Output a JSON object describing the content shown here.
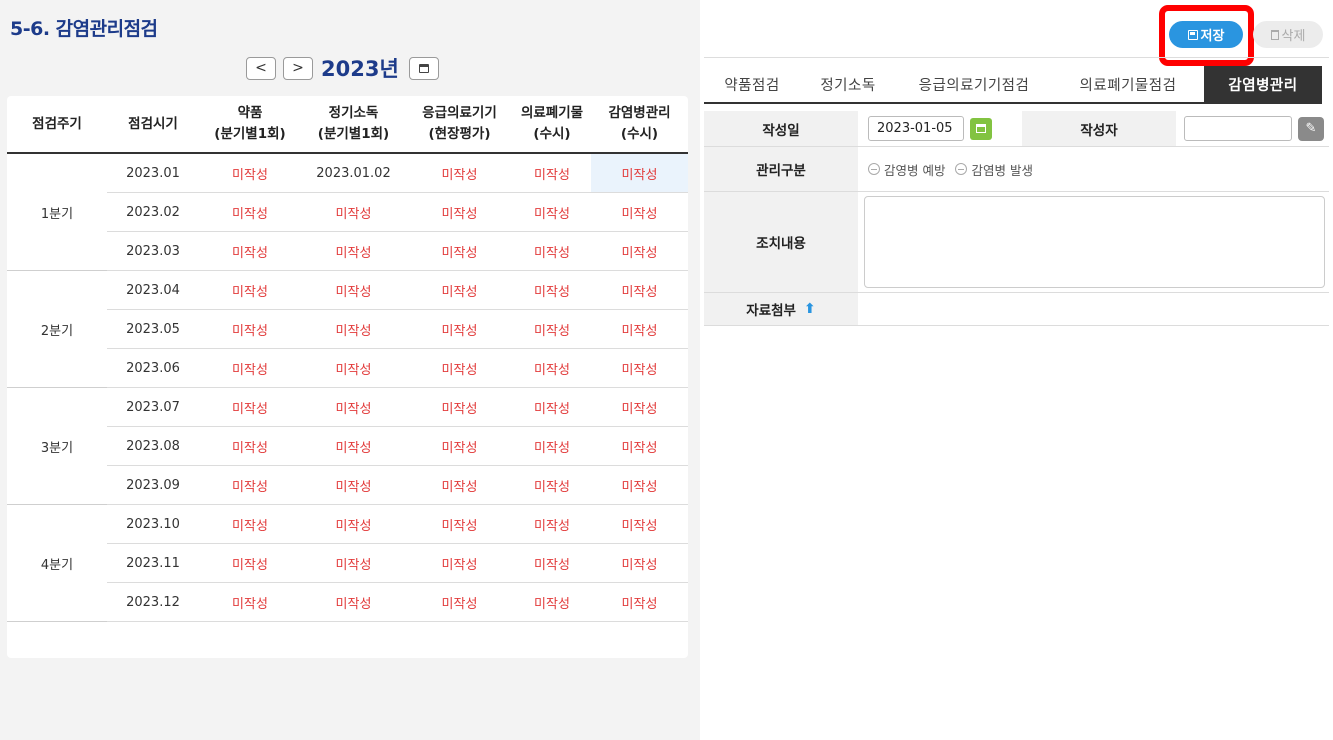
{
  "page_title": "5-6. 감염관리점검",
  "year_nav": {
    "prev": "<",
    "next": ">",
    "year": "2023년",
    "calendar_icon": "calendar-icon"
  },
  "table": {
    "headers": [
      {
        "line1": "점검주기",
        "line2": ""
      },
      {
        "line1": "점검시기",
        "line2": ""
      },
      {
        "line1": "약품",
        "line2": "(분기별1회)"
      },
      {
        "line1": "정기소독",
        "line2": "(분기별1회)"
      },
      {
        "line1": "응급의료기기",
        "line2": "(현장평가)"
      },
      {
        "line1": "의료폐기물",
        "line2": "(수시)"
      },
      {
        "line1": "감염병관리",
        "line2": "(수시)"
      }
    ],
    "quarters": [
      "1분기",
      "2분기",
      "3분기",
      "4분기"
    ],
    "rows": [
      {
        "month": "2023.01",
        "c": [
          "미작성",
          "2023.01.02",
          "미작성",
          "미작성",
          "미작성"
        ]
      },
      {
        "month": "2023.02",
        "c": [
          "미작성",
          "미작성",
          "미작성",
          "미작성",
          "미작성"
        ]
      },
      {
        "month": "2023.03",
        "c": [
          "미작성",
          "미작성",
          "미작성",
          "미작성",
          "미작성"
        ]
      },
      {
        "month": "2023.04",
        "c": [
          "미작성",
          "미작성",
          "미작성",
          "미작성",
          "미작성"
        ]
      },
      {
        "month": "2023.05",
        "c": [
          "미작성",
          "미작성",
          "미작성",
          "미작성",
          "미작성"
        ]
      },
      {
        "month": "2023.06",
        "c": [
          "미작성",
          "미작성",
          "미작성",
          "미작성",
          "미작성"
        ]
      },
      {
        "month": "2023.07",
        "c": [
          "미작성",
          "미작성",
          "미작성",
          "미작성",
          "미작성"
        ]
      },
      {
        "month": "2023.08",
        "c": [
          "미작성",
          "미작성",
          "미작성",
          "미작성",
          "미작성"
        ]
      },
      {
        "month": "2023.09",
        "c": [
          "미작성",
          "미작성",
          "미작성",
          "미작성",
          "미작성"
        ]
      },
      {
        "month": "2023.10",
        "c": [
          "미작성",
          "미작성",
          "미작성",
          "미작성",
          "미작성"
        ]
      },
      {
        "month": "2023.11",
        "c": [
          "미작성",
          "미작성",
          "미작성",
          "미작성",
          "미작성"
        ]
      },
      {
        "month": "2023.12",
        "c": [
          "미작성",
          "미작성",
          "미작성",
          "미작성",
          "미작성"
        ]
      }
    ]
  },
  "toolbar": {
    "save_label": "저장",
    "delete_label": "삭제"
  },
  "tabs": [
    {
      "label": "약품점검",
      "active": false
    },
    {
      "label": "정기소독",
      "active": false
    },
    {
      "label": "응급의료기기점검",
      "active": false
    },
    {
      "label": "의료폐기물점검",
      "active": false
    },
    {
      "label": "감염병관리",
      "active": true
    }
  ],
  "form": {
    "date_label": "작성일",
    "date_value": "2023-01-05",
    "author_label": "작성자",
    "author_value": "",
    "category_label": "관리구분",
    "category_options": [
      "감영병 예방",
      "감염병 발생"
    ],
    "action_label": "조치내용",
    "attachment_label": "자료첨부"
  },
  "colors": {
    "accent": "#1d3b8a",
    "save": "#2a95e0",
    "unwritten": "#e23b3b",
    "highlight": "#ff0000"
  }
}
